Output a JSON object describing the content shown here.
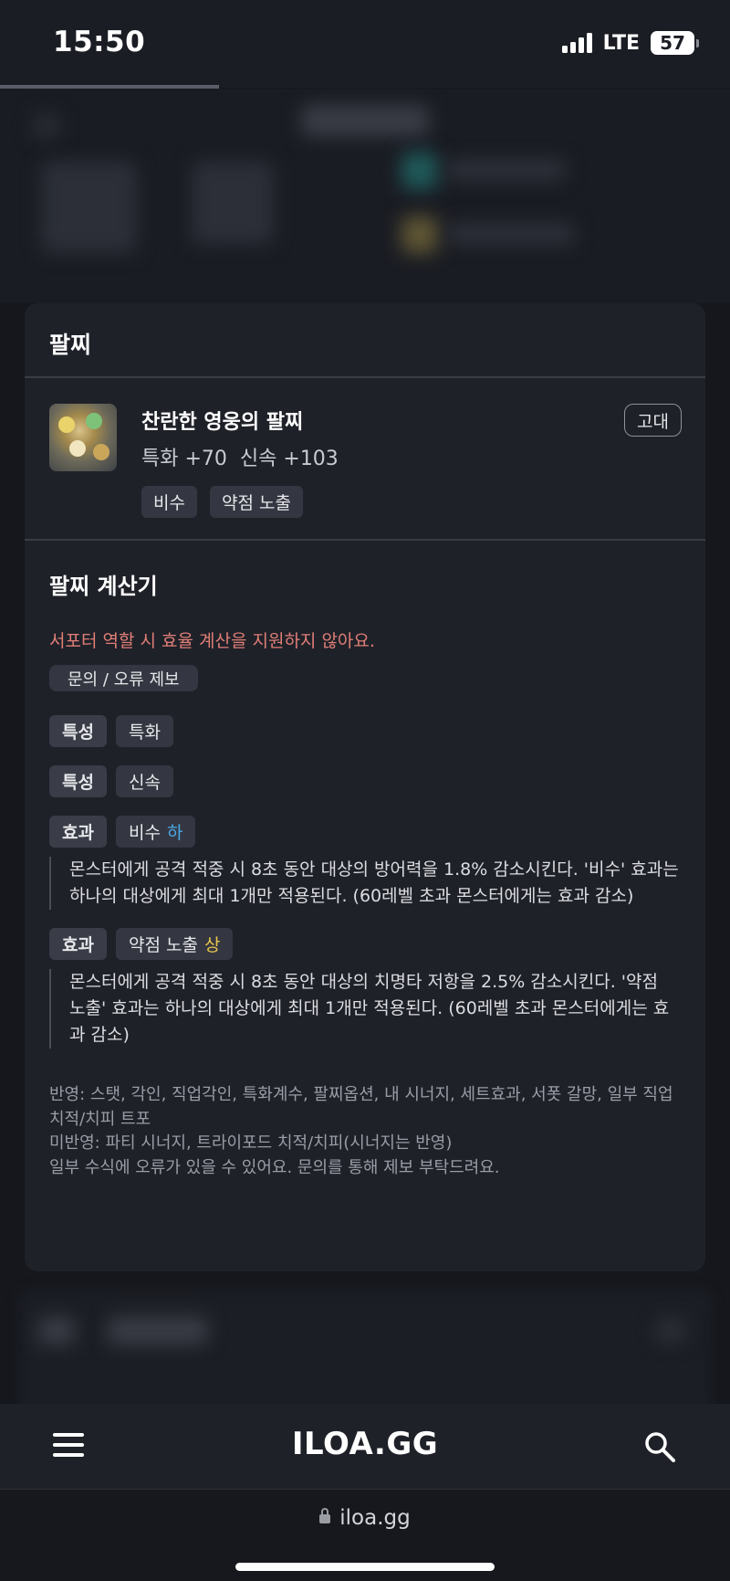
{
  "status_bar": {
    "time": "15:50",
    "network": "LTE",
    "battery": "57"
  },
  "card": {
    "title": "팔찌",
    "item": {
      "name": "찬란한 영웅의 팔찌",
      "stats": [
        "특화 +70",
        "신속 +103"
      ],
      "grade": "고대",
      "tags": [
        "비수",
        "약점 노출"
      ]
    },
    "calculator": {
      "title": "팔찌 계산기",
      "warning": "서포터 역할 시 효율 계산을 지원하지 않아요.",
      "report_button": "문의 / 오류 제보",
      "rows": [
        {
          "label": "특성",
          "value": "특화"
        },
        {
          "label": "특성",
          "value": "신속"
        }
      ],
      "effects": [
        {
          "label": "효과",
          "name": "비수",
          "level": "하",
          "description": "몬스터에게 공격 적중 시 8초 동안 대상의 방어력을 1.8% 감소시킨다. '비수' 효과는 하나의 대상에게 최대 1개만 적용된다. (60레벨 초과 몬스터에게는 효과 감소)"
        },
        {
          "label": "효과",
          "name": "약점 노출",
          "level": "상",
          "description": "몬스터에게 공격 적중 시 8초 동안 대상의 치명타 저항을 2.5% 감소시킨다. '약점 노출' 효과는 하나의 대상에게 최대 1개만 적용된다. (60레벨 초과 몬스터에게는 효과 감소)"
        }
      ],
      "notes": [
        "반영: 스탯, 각인, 직업각인, 특화계수, 팔찌옵션, 내 시너지, 세트효과, 서폿 갈망, 일부 직업 치적/치피 트포",
        "미반영: 파티 시너지, 트라이포드 치적/치피(시너지는 반영)",
        "일부 수식에 오류가 있을 수 있어요. 문의를 통해 제보 부탁드려요."
      ]
    }
  },
  "navbar": {
    "logo": "ILOA.GG"
  },
  "url_bar": {
    "url": "iloa.gg"
  },
  "colors": {
    "warning": "#e07f76",
    "level_low": "#49a9ea",
    "level_high": "#e8c54b"
  },
  "icons": [
    "menu-icon",
    "search-icon",
    "lock-icon",
    "bracelet-item-icon"
  ]
}
